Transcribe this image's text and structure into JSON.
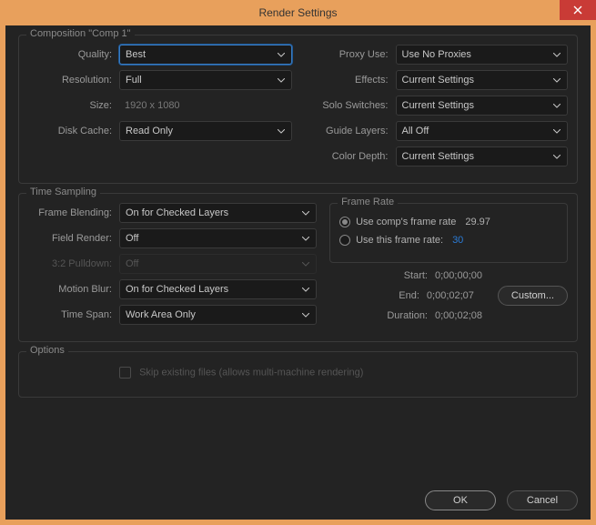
{
  "title": "Render Settings",
  "comp": {
    "section_title": "Composition \"Comp 1\"",
    "left": {
      "quality_label": "Quality:",
      "quality_value": "Best",
      "resolution_label": "Resolution:",
      "resolution_value": "Full",
      "size_label": "Size:",
      "size_value": "1920 x 1080",
      "diskcache_label": "Disk Cache:",
      "diskcache_value": "Read Only"
    },
    "right": {
      "proxy_label": "Proxy Use:",
      "proxy_value": "Use No Proxies",
      "effects_label": "Effects:",
      "effects_value": "Current Settings",
      "solo_label": "Solo Switches:",
      "solo_value": "Current Settings",
      "guide_label": "Guide Layers:",
      "guide_value": "All Off",
      "depth_label": "Color Depth:",
      "depth_value": "Current Settings"
    }
  },
  "time": {
    "section_title": "Time Sampling",
    "fb_label": "Frame Blending:",
    "fb_value": "On for Checked Layers",
    "fr_label": "Field Render:",
    "fr_value": "Off",
    "pd_label": "3:2 Pulldown:",
    "pd_value": "Off",
    "mb_label": "Motion Blur:",
    "mb_value": "On for Checked Layers",
    "ts_label": "Time Span:",
    "ts_value": "Work Area Only",
    "framerate": {
      "title": "Frame Rate",
      "opt1_label": "Use comp's frame rate",
      "opt1_value": "29.97",
      "opt2_label": "Use this frame rate:",
      "opt2_value": "30"
    },
    "times": {
      "start_label": "Start:",
      "start_value": "0;00;00;00",
      "end_label": "End:",
      "end_value": "0;00;02;07",
      "dur_label": "Duration:",
      "dur_value": "0;00;02;08",
      "custom_label": "Custom..."
    }
  },
  "options": {
    "section_title": "Options",
    "skip_label": "Skip existing files (allows multi-machine rendering)"
  },
  "footer": {
    "ok": "OK",
    "cancel": "Cancel"
  }
}
